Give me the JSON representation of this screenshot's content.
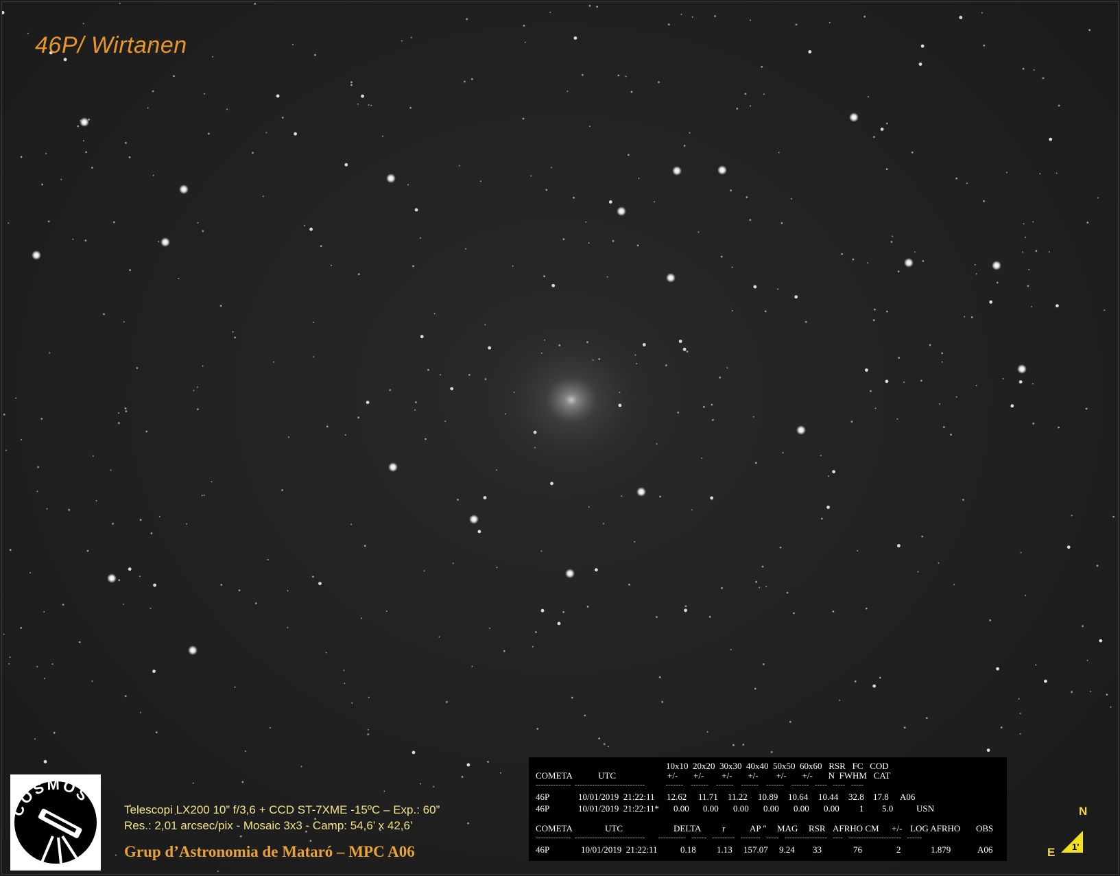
{
  "title": "46P/ Wirtanen",
  "logo": {
    "text": "COSMOS",
    "icon": "telescope-logo-icon"
  },
  "caption": {
    "line1": "Telescopi LX200 10” f/3,6 + CCD ST-7XME -15ºC – Exp.: 60”",
    "line2": "Res.: 2,01 arcsec/pix  -  Mosaic 3x3 - Camp: 54,6’ x 42,6’"
  },
  "group_label": "Grup d’Astronomia de Mataró – MPC A06",
  "table": {
    "h1_top": "10x10  20x20  30x30  40x40  50x50  60x60   RSR   FC   COD",
    "h1_cometa": "COMETA",
    "h1_utc": "UTC",
    "h1_bottom": "+/-       +/-        +/-       +/-        +/-       +/-       N  FWHM   CAT",
    "row1": [
      "46P",
      "10/01/2019  21:22:11",
      "12.62",
      "11.71",
      "11.22",
      "10.89",
      "10.64",
      "10.44",
      "32.8",
      "17.8",
      "A06"
    ],
    "row2": [
      "46P",
      "10/01/2019  21:22:11*",
      "0.00",
      "0.00",
      "0.00",
      "0.00",
      "0.00",
      "0.00",
      "1",
      "5.0",
      "USN"
    ],
    "h2": [
      "COMETA",
      "UTC",
      "DELTA",
      "r",
      "AP \"",
      "MAG",
      "RSR",
      "AFRHO CM",
      "+/-",
      "LOG AFRHO",
      "OBS"
    ],
    "row3": [
      "46P",
      "10/01/2019  21:22:11",
      "0.18",
      "1.13",
      "157.07",
      "9.24",
      "33",
      "76",
      "2",
      "1.879",
      "A06"
    ]
  },
  "compass": {
    "north": "N",
    "east": "E",
    "scale": "1'"
  },
  "colors": {
    "title": "#e8962a",
    "caption": "#f2e38a",
    "group": "#e8a23a",
    "compass": "#f0d64a",
    "sky": "#222222"
  }
}
